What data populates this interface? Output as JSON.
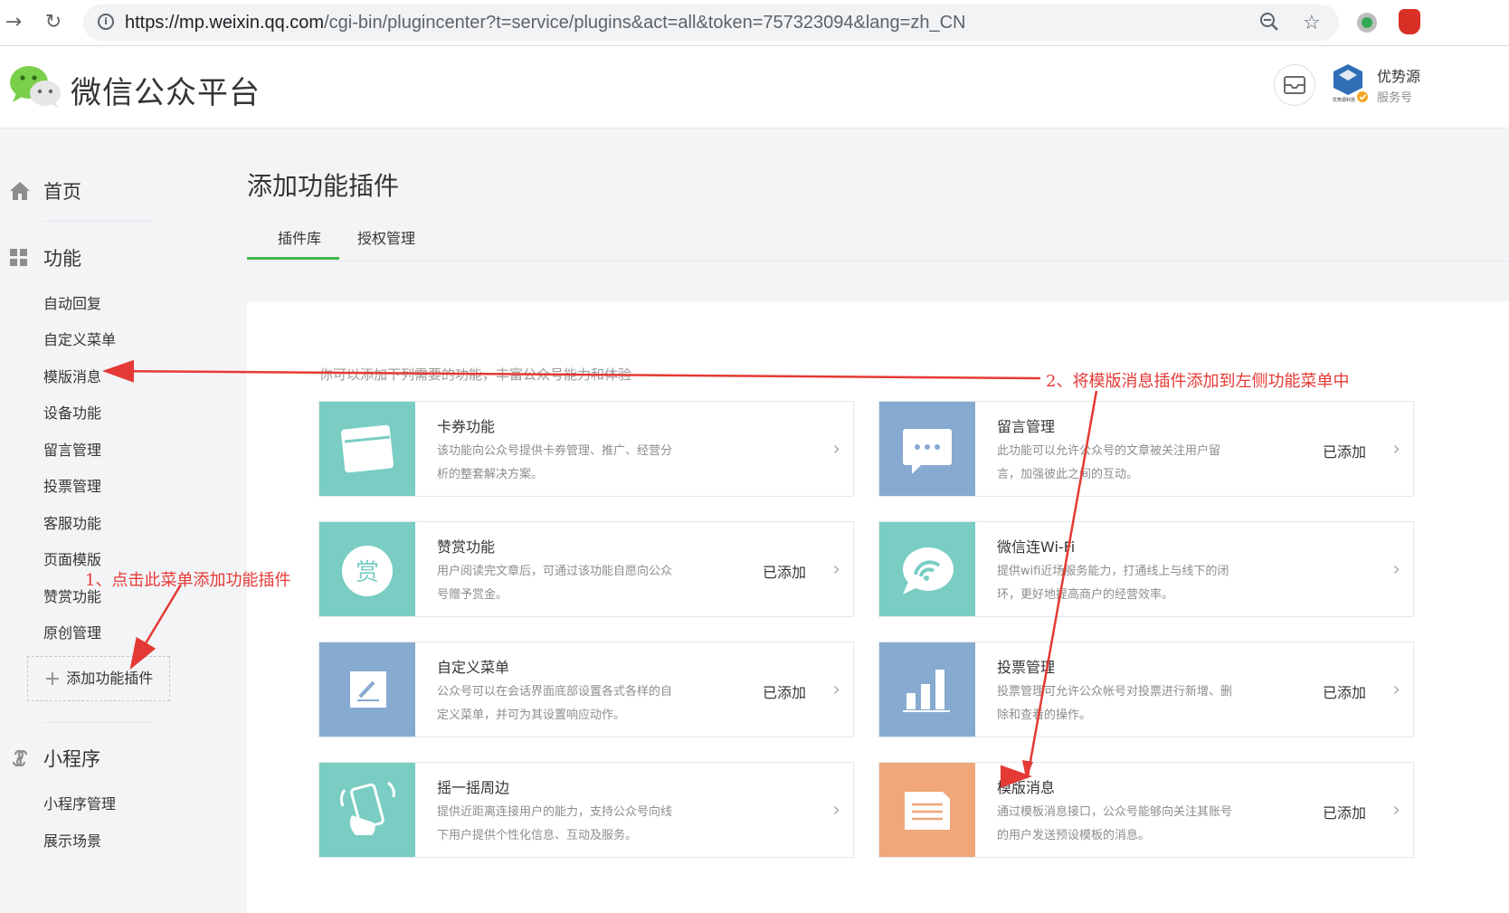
{
  "browser": {
    "url_host": "https://mp.weixin.qq.com",
    "url_path": "/cgi-bin/plugincenter?t=service/plugins&act=all&token=757323094&lang=zh_CN"
  },
  "header": {
    "site_title": "微信公众平台",
    "account_name": "优势源",
    "account_type": "服务号"
  },
  "sidebar": {
    "home": "首页",
    "function_section": "功能",
    "items": [
      "自动回复",
      "自定义菜单",
      "模版消息",
      "设备功能",
      "留言管理",
      "投票管理",
      "客服功能",
      "页面模版",
      "赞赏功能",
      "原创管理"
    ],
    "add_plugin": "添加功能插件",
    "miniprogram_section": "小程序",
    "mini_items": [
      "小程序管理",
      "展示场景"
    ]
  },
  "main": {
    "page_title": "添加功能插件",
    "tabs": [
      "插件库",
      "授权管理"
    ],
    "intro": "你可以添加下列需要的功能，丰富公众号能力和体验"
  },
  "plugins": [
    {
      "title": "卡券功能",
      "desc": "该功能向公众号提供卡券管理、推广、经营分析的整套解决方案。",
      "status": "",
      "color": "#79cdc3",
      "icon": "card-icon"
    },
    {
      "title": "留言管理",
      "desc": "此功能可以允许公众号的文章被关注用户留言，加强彼此之间的互动。",
      "status": "已添加",
      "color": "#86aad0",
      "icon": "comment-icon"
    },
    {
      "title": "赞赏功能",
      "desc": "用户阅读完文章后，可通过该功能自愿向公众号赠予赏金。",
      "status": "已添加",
      "color": "#79cdc3",
      "icon": "reward-icon"
    },
    {
      "title": "微信连Wi-Fi",
      "desc": "提供wifi近场服务能力，打通线上与线下的闭环，更好地提高商户的经营效率。",
      "status": "",
      "color": "#79cdc3",
      "icon": "wifi-icon"
    },
    {
      "title": "自定义菜单",
      "desc": "公众号可以在会话界面底部设置各式各样的自定义菜单，并可为其设置响应动作。",
      "status": "已添加",
      "color": "#86aad0",
      "icon": "edit-icon"
    },
    {
      "title": "投票管理",
      "desc": "投票管理可允许公众帐号对投票进行新增、删除和查看的操作。",
      "status": "已添加",
      "color": "#86aad0",
      "icon": "bar-chart-icon"
    },
    {
      "title": "摇一摇周边",
      "desc": "提供近距离连接用户的能力，支持公众号向线下用户提供个性化信息、互动及服务。",
      "status": "",
      "color": "#79cdc3",
      "icon": "shake-icon"
    },
    {
      "title": "模版消息",
      "desc": "通过模板消息接口，公众号能够向关注其账号的用户发送预设模板的消息。",
      "status": "已添加",
      "color": "#f0a77a",
      "icon": "template-icon"
    }
  ],
  "annotations": {
    "step1": "1、点击此菜单添加功能插件",
    "step2": "2、将模版消息插件添加到左侧功能菜单中"
  }
}
